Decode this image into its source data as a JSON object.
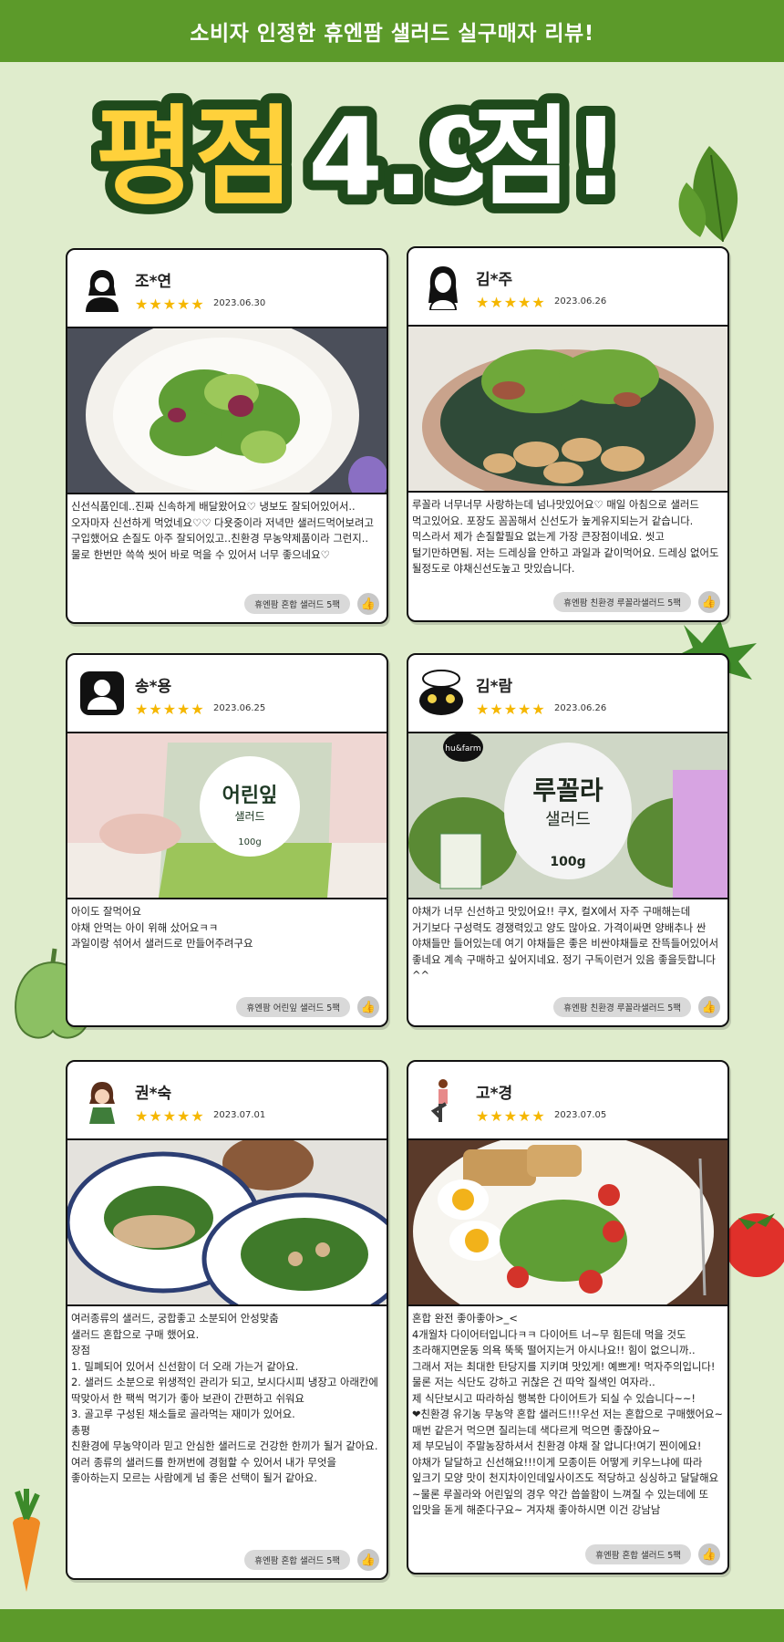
{
  "banner": {
    "title": "소비자 인정한 휴엔팜 샐러드 실구매자 리뷰!"
  },
  "headline": {
    "label": "평점",
    "score": "4.9",
    "suffix": "점!"
  },
  "reviews": [
    {
      "name": "조*연",
      "stars": "★★★★★",
      "date": "2023.06.30",
      "text": "신선식품인데..진짜 신속하게 배달왔어요♡ 냉보도 잘되어있어서.. 오자마자 신선하게 먹었네요♡♡ 다욧중이라 저녁만 샐러드먹어보려고 구입했어요 손질도 아주 잘되어있고..친환경 무농약제품이라 그런지..물로 한번만 쓱쓱 씻어 바로 먹을 수 있어서 너무 좋으네요♡",
      "product": "휴엔팜 혼합 샐러드 5팩",
      "photo": "salad-plate-photo"
    },
    {
      "name": "김*주",
      "stars": "★★★★★",
      "date": "2023.06.26",
      "text": "루꼴라 너무너무 사랑하는데 넘나맛있어요♡ 매일 아침으로 샐러드 먹고있어요. 포장도 꼼꼼해서 신선도가 높게유지되는거 같습니다. 믹스라서 제가 손질할필요 없는게 가장 큰장점이네요. 씻고 털기만하면됨. 저는 드레싱을 안하고 과일과 같이먹어요. 드레싱 없어도 될정도로 야채신선도높고 맛있습니다.",
      "product": "휴엔팜 친환경 루꼴라샐러드 5팩",
      "photo": "chicken-salad-photo"
    },
    {
      "name": "송*용",
      "stars": "★★★★★",
      "date": "2023.06.25",
      "text": "아이도 잘먹어요\n야채 안먹는 아이 위해 샀어요ㅋㅋ\n과일이랑 섞어서 샐러드로 만들어주려구요",
      "product": "휴엔팜 어린잎 샐러드 5팩",
      "photo": "baby-leaf-package-photo",
      "pack_name": "어린잎",
      "pack_sub": "샐러드",
      "pack_weight": "100g"
    },
    {
      "name": "김*람",
      "stars": "★★★★★",
      "date": "2023.06.26",
      "text": "야채가 너무 신선하고 맛있어요!! 쿠X, 컬X에서 자주 구매해는데 거기보다 구성력도 경쟁력있고 양도 많아요. 가격이싸면 양배추나 싼 야채들만 들어있는데 여기 야채들은 좋은 비싼야채들로 잔뜩들어있어서 좋네요 계속 구매하고 싶어지네요. 정기 구독이런거 있음 좋을듯합니다 ^^",
      "product": "휴엔팜 친환경 루꼴라샐러드 5팩",
      "photo": "arugula-package-photo",
      "pack_name": "루꼴라",
      "pack_sub": "샐러드",
      "pack_weight": "100g",
      "pack_brand": "hu&farm"
    },
    {
      "name": "권*숙",
      "stars": "★★★★★",
      "date": "2023.07.01",
      "text": "여러종류의 샐러드, 궁합좋고 소분되어 안성맞춤\n샐러드 혼합으로 구매 했어요.\n장점\n1. 밀폐되어 있어서 신선함이 더 오래 가는거 같아요.\n2. 샐러드 소분으로 위생적인 관리가 되고, 보시다시피 냉장고 아래칸에 딱맞아서 한 팩씩 먹기가 좋아 보관이 간편하고 쉬워요\n3. 골고루 구성된 채소들로 골라먹는 재미가 있어요.\n총평\n친환경에 무농약이라 믿고 안심한 샐러드로 건강한 한끼가 될거 같아요. 여러 종류의 샐러드를 한꺼번에 경험할 수 있어서 내가 무엇을 좋아하는지 모르는 사람에게 넘 좋은 선택이 될거 같아요.",
      "product": "휴엔팜 혼합 샐러드 5팩",
      "photo": "two-salad-plates-photo"
    },
    {
      "name": "고*경",
      "stars": "★★★★★",
      "date": "2023.07.05",
      "text": "혼합 완전 좋아좋아>_<\n4개월차 다이어터입니다ㅋㅋ 다이어트 너~무 힘든데 먹을 것도 초라해지면운동 의욕 뚝뚝 떨어지는거 아시나요!! 힘이 없으니까..\n그래서 저는 최대한 탄당지를 지키며 맛있게! 예쁘게! 먹자주의입니다! 물론 저는 식단도 강하고 귀찮은 건 따악 질색인 여자라..\n제 식단보시고 따라하심 행복한 다이어트가 되실 수 있습니다~~!\n❤친환경 유기농 무농약 혼합 샐러드!!!우선 저는 혼합으로 구매했어요~매번 같은거 먹으면 질리는데 색다르게 먹으면 좋잖아요~\n제 부모님이 주말농장하셔서 친환경 야채 잘 압니다!여기 찐이에요!야채가 달달하고 신선해요!!!이게 모종이든 어떻게 키우느냐에 따라 잎크기 모양 맛이 천지차이인데잎사이즈도 적당하고 싱싱하고 달달해요~물론 루꼴라와 어린잎의 경우 약간 씁쓸함이 느껴질 수 있는데에 또 입맛을 돋게 해준다구요~ 겨자채 좋아하시면 이건 강남남",
      "product": "휴엔팜 혼합 샐러드 5팩",
      "photo": "egg-salad-photo"
    }
  ],
  "icons": {
    "thumb": "thumbs-up-icon",
    "leaf": "spinach-leaf-icon",
    "pepper": "green-pepper-icon",
    "carrot": "carrot-icon",
    "tomato": "tomato-icon"
  },
  "colors": {
    "brand_green": "#5c9a2a",
    "background": "#dfeccc",
    "star": "#f5b700",
    "headline_yellow": "#ffd13b",
    "headline_dark": "#1f4a1c"
  }
}
